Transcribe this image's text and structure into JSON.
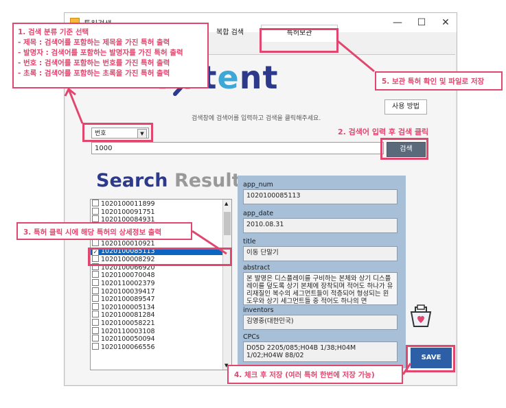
{
  "window": {
    "title": "특허검색",
    "minimize_glyph": "—",
    "maximize_glyph": "☐",
    "close_glyph": "✕"
  },
  "tabs": [
    {
      "label": "복합 검색",
      "active": false
    },
    {
      "label": "특허보관",
      "active": true
    }
  ],
  "logo": {
    "text_a": "Pat",
    "text_e": "e",
    "text_b": "nt"
  },
  "howto_button": "사용 방법",
  "hint": "검색창에 검색어를 입력하고 검색을 클릭해주세요.",
  "search": {
    "category": "번호",
    "query": "1000",
    "button_label": "검색"
  },
  "result_heading": {
    "part1": "Search",
    "part2": "Result"
  },
  "results": [
    {
      "id": "1020100011899",
      "checked": false
    },
    {
      "id": "1020100091751",
      "checked": false
    },
    {
      "id": "1020100084931",
      "checked": false
    },
    {
      "id": "1020100010927",
      "checked": false
    },
    {
      "id": "1020100042371",
      "checked": false
    },
    {
      "id": "1020100010921",
      "checked": false
    },
    {
      "id": "1020100085113",
      "checked": true,
      "selected": true
    },
    {
      "id": "1020100008292",
      "checked": false
    },
    {
      "id": "1020100066920",
      "checked": false
    },
    {
      "id": "1020100070048",
      "checked": false
    },
    {
      "id": "1020110002379",
      "checked": false
    },
    {
      "id": "1020100039417",
      "checked": false
    },
    {
      "id": "1020100089547",
      "checked": false
    },
    {
      "id": "1020100005134",
      "checked": false
    },
    {
      "id": "1020100081284",
      "checked": false
    },
    {
      "id": "1020100058221",
      "checked": false
    },
    {
      "id": "1020110003108",
      "checked": false
    },
    {
      "id": "1020100050094",
      "checked": false
    },
    {
      "id": "1020100066556",
      "checked": false
    }
  ],
  "details": {
    "app_num_label": "app_num",
    "app_num": "1020100085113",
    "app_date_label": "app_date",
    "app_date": "2010.08.31",
    "title_label": "title",
    "title": "이동 단말기",
    "abstract_label": "abstract",
    "abstract": "본 발명은 디스플레이를 구비하는 본체와 상기 디스플레이를 덮도록 상기 본체에 장착되며 적어도 하나가 유리재질인 복수의 세그먼트들이 적층되어 형성되는 윈도우와 상기 세그먼트들 중 적어도 하나의 면",
    "inventors_label": "inventors",
    "inventors": "김영중(대한민국)",
    "cpcs_label": "CPCs",
    "cpcs": "D05D 2205/085;H04B 1/38;H04M 1/02;H04W 88/02"
  },
  "save_button": "SAVE",
  "annotations": {
    "note1_title": "1. 검색 분류 기준 선택",
    "note1_lines": [
      "- 제목 : 검색어를 포함하는 제목을 가진 특허 출력",
      "- 발명자 : 검색어를 포함하는 발명자를 가진 특허 출력",
      "- 번호 : 검색어를 포함하는 번호를 가진 특허 출력",
      "- 초록 : 검색어를 포함하는 초록을 가진 특허 출력"
    ],
    "note2": "2. 검색어 입력 후 검색 클릭",
    "note3": "3. 특허 클릭 시에 해당 특허의 상세정보 출력",
    "note4": "4. 체크 후 저장 (여러 특허 한번에 저장 가능)",
    "note5": "5. 보관 특허 확인 및 파일로 저장"
  },
  "colors": {
    "accent_red": "#e0466e",
    "logo_blue": "#2d3a8c",
    "logo_light_blue": "#3fa7d6",
    "detail_panel": "#a7bfd7",
    "save_button": "#2d5fa6",
    "selection": "#0a66c2"
  }
}
